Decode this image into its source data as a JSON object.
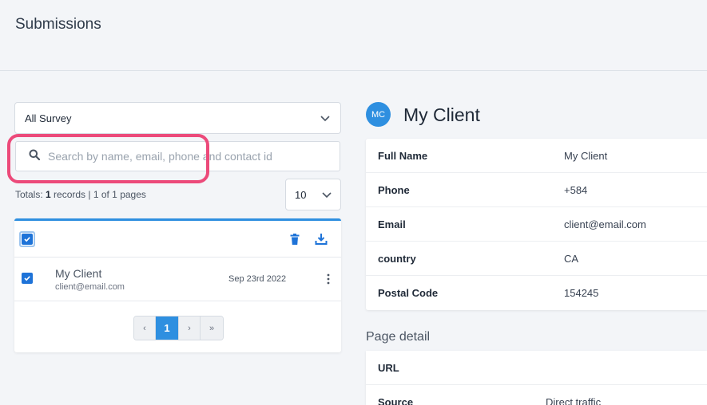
{
  "header": {
    "title": "Submissions"
  },
  "filters": {
    "survey_select": {
      "value": "All Survey"
    },
    "search": {
      "placeholder": "Search by name, email, phone and contact id",
      "value": ""
    },
    "totals": {
      "prefix": "Totals: ",
      "count": "1",
      "suffix": " records | 1 of 1 pages"
    },
    "per_page": {
      "value": "10"
    }
  },
  "list": {
    "toolbar": {
      "select_all_checked": true,
      "delete_icon": "trash-icon",
      "download_icon": "download-icon"
    },
    "rows": [
      {
        "name": "My Client",
        "email": "client@email.com",
        "date": "Sep 23rd 2022",
        "checked": true
      }
    ],
    "pagination": {
      "prev": "‹",
      "current": "1",
      "next": "›",
      "last": "»"
    }
  },
  "contact": {
    "avatar_initials": "MC",
    "name": "My Client",
    "fields": [
      {
        "label": "Full Name",
        "value": "My Client"
      },
      {
        "label": "Phone",
        "value": "+584"
      },
      {
        "label": "Email",
        "value": "client@email.com"
      },
      {
        "label": "country",
        "value": "CA"
      },
      {
        "label": "Postal Code",
        "value": "154245"
      }
    ]
  },
  "page_detail": {
    "title": "Page detail",
    "fields": [
      {
        "label": "URL",
        "value": ""
      },
      {
        "label": "Source",
        "value": "Direct traffic"
      }
    ]
  },
  "colors": {
    "accent": "#2e8fe0",
    "highlight": "#ec4a7a",
    "checkbox": "#1e73d8"
  }
}
